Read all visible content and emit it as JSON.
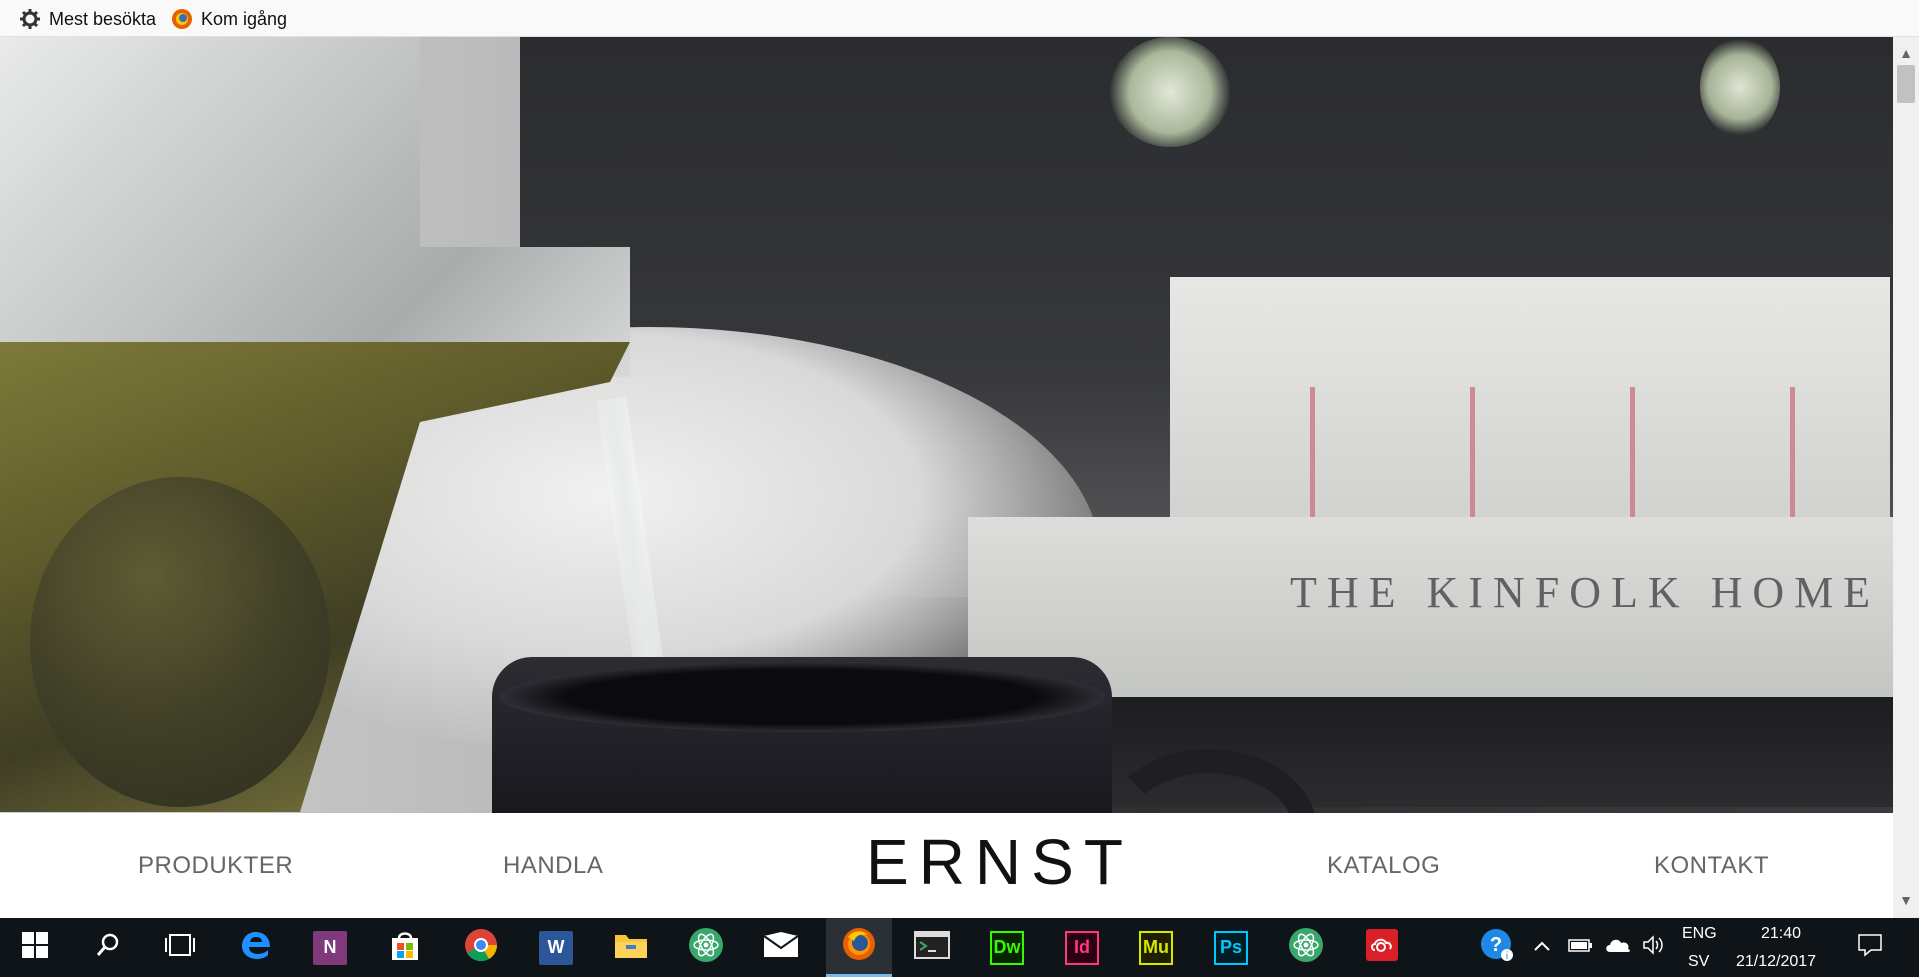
{
  "bookmarks": {
    "items": [
      {
        "label": "Mest besökta",
        "icon": "gear-icon"
      },
      {
        "label": "Kom igång",
        "icon": "firefox-icon"
      }
    ]
  },
  "hero": {
    "book_title": "THE KINFOLK HOME"
  },
  "nav": {
    "items": [
      "PRODUKTER",
      "HANDLA",
      "KATALOG",
      "KONTAKT"
    ],
    "brand": "ERNST"
  },
  "taskbar": {
    "apps": [
      {
        "name": "start-button",
        "icon": "windows-logo-icon"
      },
      {
        "name": "search-button",
        "icon": "search-icon"
      },
      {
        "name": "task-view-button",
        "icon": "task-view-icon"
      },
      {
        "name": "edge-button",
        "icon": "edge-icon"
      },
      {
        "name": "onenote-button",
        "icon": "onenote-icon",
        "glyph": "N"
      },
      {
        "name": "store-button",
        "icon": "store-icon"
      },
      {
        "name": "chrome-button",
        "icon": "chrome-icon"
      },
      {
        "name": "word-button",
        "icon": "word-icon",
        "glyph": "W"
      },
      {
        "name": "file-explorer-button",
        "icon": "folder-icon"
      },
      {
        "name": "atom-button",
        "icon": "atom-icon"
      },
      {
        "name": "mail-button",
        "icon": "mail-icon"
      },
      {
        "name": "firefox-button",
        "icon": "firefox-icon"
      },
      {
        "name": "terminal-button",
        "icon": "terminal-icon"
      },
      {
        "name": "dreamweaver-button",
        "icon": "dreamweaver-icon",
        "glyph": "Dw"
      },
      {
        "name": "indesign-button",
        "icon": "indesign-icon",
        "glyph": "Id"
      },
      {
        "name": "muse-button",
        "icon": "muse-icon",
        "glyph": "Mu"
      },
      {
        "name": "photoshop-button",
        "icon": "photoshop-icon",
        "glyph": "Ps"
      },
      {
        "name": "atom-button-2",
        "icon": "atom-icon"
      },
      {
        "name": "creative-cloud-button",
        "icon": "creative-cloud-icon"
      }
    ],
    "tray": {
      "language_top": "ENG",
      "language_bottom": "SV",
      "time": "21:40",
      "date": "21/12/2017"
    }
  },
  "colors": {
    "taskbar_bg": "#0f1418",
    "active_indicator": "#76b9ed",
    "nav_text": "#666666",
    "brand_text": "#111111"
  }
}
